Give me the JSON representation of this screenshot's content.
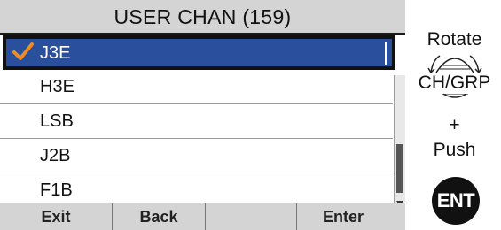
{
  "screen": {
    "title": "USER CHAN (159)",
    "selected_index": 0,
    "items": [
      {
        "label": "J3E",
        "checked": true
      },
      {
        "label": "H3E",
        "checked": false
      },
      {
        "label": "LSB",
        "checked": false
      },
      {
        "label": "J2B",
        "checked": false
      },
      {
        "label": "F1B",
        "checked": false
      }
    ],
    "softkeys": [
      "Exit",
      "Back",
      "",
      "Enter"
    ]
  },
  "instructions": {
    "rotate": "Rotate",
    "knob_label": "CH/GRP",
    "plus": "+",
    "push": "Push",
    "ent_button": "ENT"
  },
  "colors": {
    "selection_bg": "#2a4f9c",
    "check": "#f28c1e",
    "titlebar_bg": "#d4d4d4"
  },
  "icons": {
    "check": "check-icon",
    "knob": "rotary-knob-icon",
    "ent": "ent-button"
  }
}
